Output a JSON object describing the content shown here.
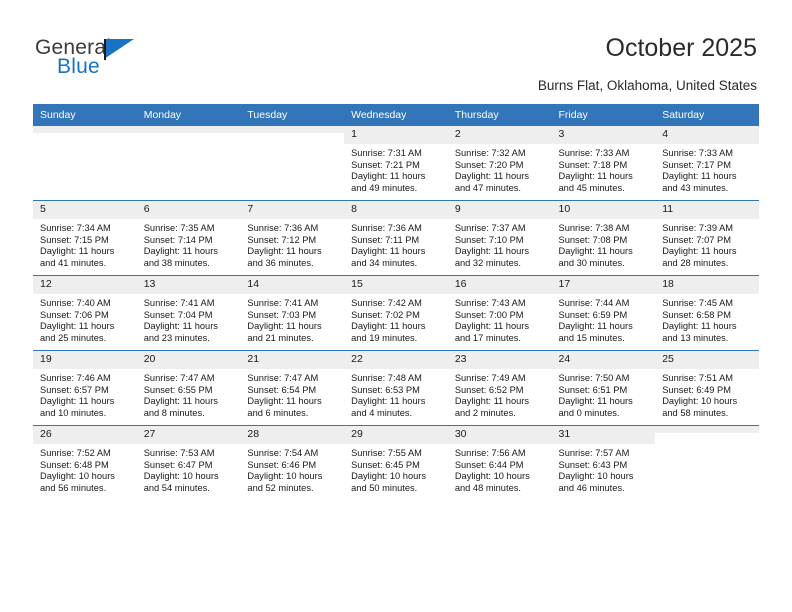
{
  "brand": {
    "name_part1": "General",
    "name_part2": "Blue",
    "flag_icon": "triangle-flag-icon",
    "accent_color": "#1a72c4"
  },
  "header": {
    "title": "October 2025",
    "location": "Burns Flat, Oklahoma, United States"
  },
  "theme": {
    "header_bar_color": "#3275b8",
    "daynum_strip_color": "#eeeeee",
    "row_divider_color": "#3275b8"
  },
  "calendar": {
    "columns": [
      "Sunday",
      "Monday",
      "Tuesday",
      "Wednesday",
      "Thursday",
      "Friday",
      "Saturday"
    ],
    "labels": {
      "sunrise": "Sunrise:",
      "sunset": "Sunset:",
      "daylight": "Daylight:"
    },
    "weeks": [
      [
        {
          "day": "",
          "empty": true
        },
        {
          "day": "",
          "empty": true
        },
        {
          "day": "",
          "empty": true
        },
        {
          "day": "1",
          "sunrise": "Sunrise: 7:31 AM",
          "sunset": "Sunset: 7:21 PM",
          "daylight_line1": "Daylight: 11 hours",
          "daylight_line2": "and 49 minutes."
        },
        {
          "day": "2",
          "sunrise": "Sunrise: 7:32 AM",
          "sunset": "Sunset: 7:20 PM",
          "daylight_line1": "Daylight: 11 hours",
          "daylight_line2": "and 47 minutes."
        },
        {
          "day": "3",
          "sunrise": "Sunrise: 7:33 AM",
          "sunset": "Sunset: 7:18 PM",
          "daylight_line1": "Daylight: 11 hours",
          "daylight_line2": "and 45 minutes."
        },
        {
          "day": "4",
          "sunrise": "Sunrise: 7:33 AM",
          "sunset": "Sunset: 7:17 PM",
          "daylight_line1": "Daylight: 11 hours",
          "daylight_line2": "and 43 minutes."
        }
      ],
      [
        {
          "day": "5",
          "sunrise": "Sunrise: 7:34 AM",
          "sunset": "Sunset: 7:15 PM",
          "daylight_line1": "Daylight: 11 hours",
          "daylight_line2": "and 41 minutes."
        },
        {
          "day": "6",
          "sunrise": "Sunrise: 7:35 AM",
          "sunset": "Sunset: 7:14 PM",
          "daylight_line1": "Daylight: 11 hours",
          "daylight_line2": "and 38 minutes."
        },
        {
          "day": "7",
          "sunrise": "Sunrise: 7:36 AM",
          "sunset": "Sunset: 7:12 PM",
          "daylight_line1": "Daylight: 11 hours",
          "daylight_line2": "and 36 minutes."
        },
        {
          "day": "8",
          "sunrise": "Sunrise: 7:36 AM",
          "sunset": "Sunset: 7:11 PM",
          "daylight_line1": "Daylight: 11 hours",
          "daylight_line2": "and 34 minutes."
        },
        {
          "day": "9",
          "sunrise": "Sunrise: 7:37 AM",
          "sunset": "Sunset: 7:10 PM",
          "daylight_line1": "Daylight: 11 hours",
          "daylight_line2": "and 32 minutes."
        },
        {
          "day": "10",
          "sunrise": "Sunrise: 7:38 AM",
          "sunset": "Sunset: 7:08 PM",
          "daylight_line1": "Daylight: 11 hours",
          "daylight_line2": "and 30 minutes."
        },
        {
          "day": "11",
          "sunrise": "Sunrise: 7:39 AM",
          "sunset": "Sunset: 7:07 PM",
          "daylight_line1": "Daylight: 11 hours",
          "daylight_line2": "and 28 minutes."
        }
      ],
      [
        {
          "day": "12",
          "sunrise": "Sunrise: 7:40 AM",
          "sunset": "Sunset: 7:06 PM",
          "daylight_line1": "Daylight: 11 hours",
          "daylight_line2": "and 25 minutes."
        },
        {
          "day": "13",
          "sunrise": "Sunrise: 7:41 AM",
          "sunset": "Sunset: 7:04 PM",
          "daylight_line1": "Daylight: 11 hours",
          "daylight_line2": "and 23 minutes."
        },
        {
          "day": "14",
          "sunrise": "Sunrise: 7:41 AM",
          "sunset": "Sunset: 7:03 PM",
          "daylight_line1": "Daylight: 11 hours",
          "daylight_line2": "and 21 minutes."
        },
        {
          "day": "15",
          "sunrise": "Sunrise: 7:42 AM",
          "sunset": "Sunset: 7:02 PM",
          "daylight_line1": "Daylight: 11 hours",
          "daylight_line2": "and 19 minutes."
        },
        {
          "day": "16",
          "sunrise": "Sunrise: 7:43 AM",
          "sunset": "Sunset: 7:00 PM",
          "daylight_line1": "Daylight: 11 hours",
          "daylight_line2": "and 17 minutes."
        },
        {
          "day": "17",
          "sunrise": "Sunrise: 7:44 AM",
          "sunset": "Sunset: 6:59 PM",
          "daylight_line1": "Daylight: 11 hours",
          "daylight_line2": "and 15 minutes."
        },
        {
          "day": "18",
          "sunrise": "Sunrise: 7:45 AM",
          "sunset": "Sunset: 6:58 PM",
          "daylight_line1": "Daylight: 11 hours",
          "daylight_line2": "and 13 minutes."
        }
      ],
      [
        {
          "day": "19",
          "sunrise": "Sunrise: 7:46 AM",
          "sunset": "Sunset: 6:57 PM",
          "daylight_line1": "Daylight: 11 hours",
          "daylight_line2": "and 10 minutes."
        },
        {
          "day": "20",
          "sunrise": "Sunrise: 7:47 AM",
          "sunset": "Sunset: 6:55 PM",
          "daylight_line1": "Daylight: 11 hours",
          "daylight_line2": "and 8 minutes."
        },
        {
          "day": "21",
          "sunrise": "Sunrise: 7:47 AM",
          "sunset": "Sunset: 6:54 PM",
          "daylight_line1": "Daylight: 11 hours",
          "daylight_line2": "and 6 minutes."
        },
        {
          "day": "22",
          "sunrise": "Sunrise: 7:48 AM",
          "sunset": "Sunset: 6:53 PM",
          "daylight_line1": "Daylight: 11 hours",
          "daylight_line2": "and 4 minutes."
        },
        {
          "day": "23",
          "sunrise": "Sunrise: 7:49 AM",
          "sunset": "Sunset: 6:52 PM",
          "daylight_line1": "Daylight: 11 hours",
          "daylight_line2": "and 2 minutes."
        },
        {
          "day": "24",
          "sunrise": "Sunrise: 7:50 AM",
          "sunset": "Sunset: 6:51 PM",
          "daylight_line1": "Daylight: 11 hours",
          "daylight_line2": "and 0 minutes."
        },
        {
          "day": "25",
          "sunrise": "Sunrise: 7:51 AM",
          "sunset": "Sunset: 6:49 PM",
          "daylight_line1": "Daylight: 10 hours",
          "daylight_line2": "and 58 minutes."
        }
      ],
      [
        {
          "day": "26",
          "sunrise": "Sunrise: 7:52 AM",
          "sunset": "Sunset: 6:48 PM",
          "daylight_line1": "Daylight: 10 hours",
          "daylight_line2": "and 56 minutes."
        },
        {
          "day": "27",
          "sunrise": "Sunrise: 7:53 AM",
          "sunset": "Sunset: 6:47 PM",
          "daylight_line1": "Daylight: 10 hours",
          "daylight_line2": "and 54 minutes."
        },
        {
          "day": "28",
          "sunrise": "Sunrise: 7:54 AM",
          "sunset": "Sunset: 6:46 PM",
          "daylight_line1": "Daylight: 10 hours",
          "daylight_line2": "and 52 minutes."
        },
        {
          "day": "29",
          "sunrise": "Sunrise: 7:55 AM",
          "sunset": "Sunset: 6:45 PM",
          "daylight_line1": "Daylight: 10 hours",
          "daylight_line2": "and 50 minutes."
        },
        {
          "day": "30",
          "sunrise": "Sunrise: 7:56 AM",
          "sunset": "Sunset: 6:44 PM",
          "daylight_line1": "Daylight: 10 hours",
          "daylight_line2": "and 48 minutes."
        },
        {
          "day": "31",
          "sunrise": "Sunrise: 7:57 AM",
          "sunset": "Sunset: 6:43 PM",
          "daylight_line1": "Daylight: 10 hours",
          "daylight_line2": "and 46 minutes."
        },
        {
          "day": "",
          "empty": true
        }
      ]
    ]
  }
}
